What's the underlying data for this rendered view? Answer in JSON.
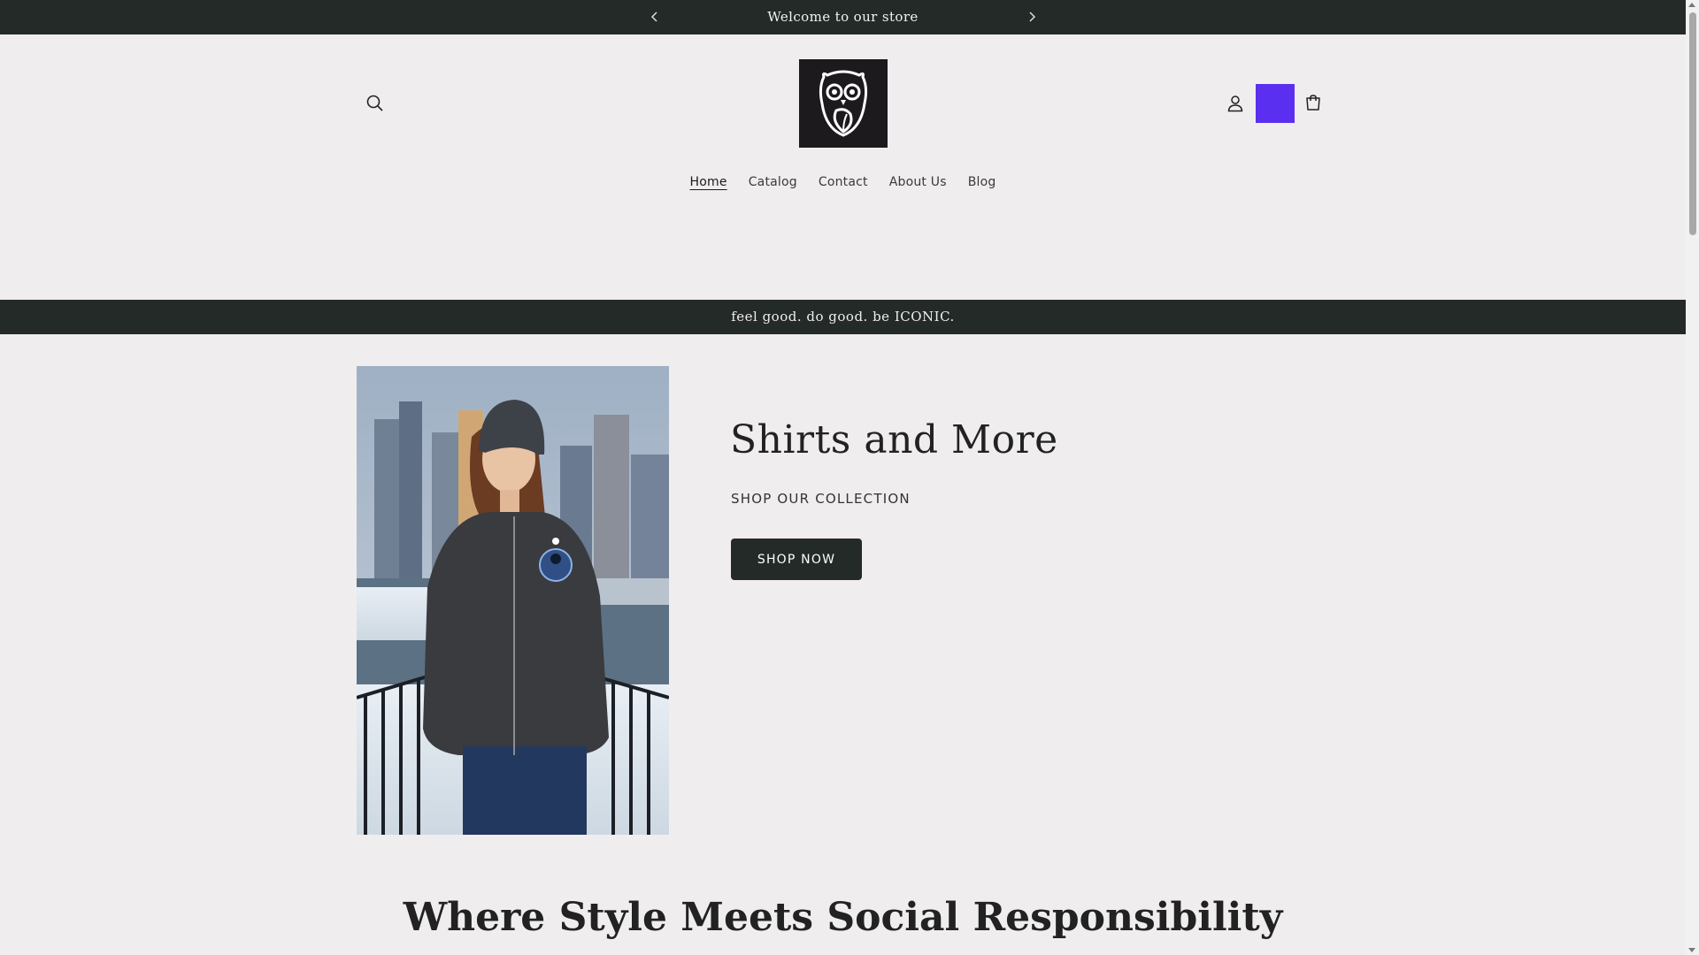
{
  "announcement": {
    "text": "Welcome to our store",
    "prev_icon": "chevron-left-icon",
    "next_icon": "chevron-right-icon"
  },
  "header": {
    "search_icon": "search-icon",
    "logo_icon": "owl-logo-icon",
    "account_icon": "user-icon",
    "cart_icon": "cart-icon",
    "highlight_color": "#5b2ff0"
  },
  "nav": {
    "items": [
      {
        "label": "Home",
        "active": true
      },
      {
        "label": "Catalog"
      },
      {
        "label": "Contact"
      },
      {
        "label": "About Us"
      },
      {
        "label": "Blog"
      }
    ]
  },
  "tagline": "feel good. do good. be ICONIC.",
  "hero": {
    "title": "Shirts and More",
    "subtitle": "SHOP OUR COLLECTION",
    "button_label": "SHOP NOW"
  },
  "section": {
    "title": "Where Style Meets Social Responsibility"
  },
  "colors": {
    "dark_bar": "#242a27",
    "page_bg": "#efedee",
    "accent": "#5b2ff0"
  }
}
